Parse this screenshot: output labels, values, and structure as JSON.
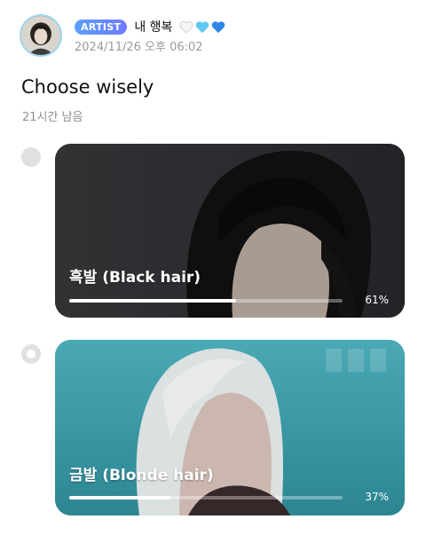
{
  "post": {
    "author": {
      "badge": "ARTIST",
      "name": "내 행복",
      "hearts": [
        {
          "icon": "white-heart-icon",
          "color": "#f3f3f3"
        },
        {
          "icon": "light-blue-heart-icon",
          "color": "#5fc8ef"
        },
        {
          "icon": "blue-heart-icon",
          "color": "#2f86e6"
        }
      ]
    },
    "timestamp": "2024/11/26 오후 06:02"
  },
  "poll": {
    "title": "Choose wisely",
    "remaining": "21시간 남음",
    "options": [
      {
        "label": "흑발 (Black hair)",
        "percent_text": "61%",
        "percent": 61,
        "selected": false
      },
      {
        "label": "금발 (Blonde hair)",
        "percent_text": "37%",
        "percent": 37,
        "selected": true
      }
    ]
  },
  "colors": {
    "accent": "#6f7bff",
    "card1_bg": "#3a3a3a",
    "card2_bg": "#3fa6b2"
  }
}
